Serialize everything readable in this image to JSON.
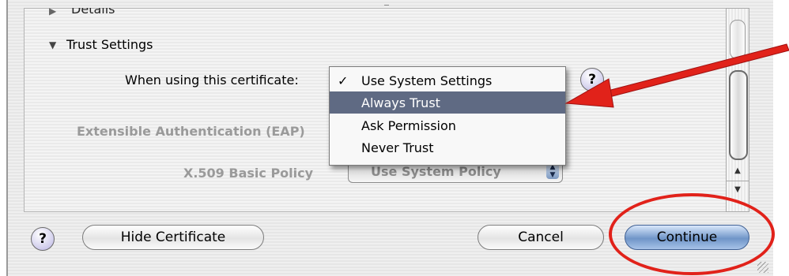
{
  "sections": {
    "details_label": "Details",
    "trust_settings_label": "Trust Settings"
  },
  "fields": {
    "using_label": "When using this certificate:",
    "eap_label": "Extensible Authentication (EAP)",
    "x509_label": "X.509 Basic Policy",
    "x509_value": "Use System Policy"
  },
  "menu": {
    "items": [
      {
        "check": "✓",
        "label": "Use System Settings"
      },
      {
        "check": "",
        "label": "Always Trust"
      },
      {
        "check": "",
        "label": "Ask Permission"
      },
      {
        "check": "",
        "label": "Never Trust"
      }
    ],
    "highlighted": "Always Trust"
  },
  "buttons": {
    "help": "?",
    "hide_certificate": "Hide Certificate",
    "cancel": "Cancel",
    "continue": "Continue"
  },
  "colors": {
    "annotation": "#e1221a",
    "menu_highlight": "#5f6a83",
    "default_button": "#6f95c8"
  },
  "icons": {
    "disclosure_collapsed": "disclosure-right-icon",
    "disclosure_expanded": "disclosure-down-icon",
    "popup_arrows": "updown-arrows-icon"
  }
}
